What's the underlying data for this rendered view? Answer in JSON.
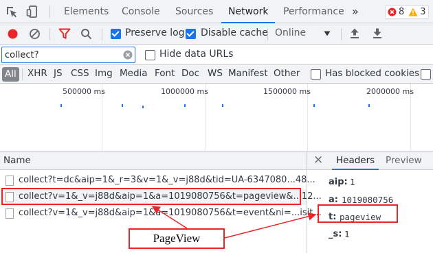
{
  "tabs": {
    "items": [
      "Elements",
      "Console",
      "Sources",
      "Network",
      "Performance"
    ],
    "active": "Network",
    "more_glyph": "»",
    "errors_count": "8",
    "warnings_count": "3"
  },
  "toolbar": {
    "preserve_log_label": "Preserve log",
    "preserve_log_checked": true,
    "disable_cache_label": "Disable cache",
    "disable_cache_checked": true,
    "throttle_value": "Online"
  },
  "filter": {
    "value": "collect?",
    "hide_data_urls_label": "Hide data URLs"
  },
  "type_filters": {
    "items": [
      "All",
      "XHR",
      "JS",
      "CSS",
      "Img",
      "Media",
      "Font",
      "Doc",
      "WS",
      "Manifest",
      "Other"
    ],
    "has_blocked_cookies_label": "Has blocked cookies"
  },
  "timeline": {
    "ticks": [
      "500000 ms",
      "1000000 ms",
      "1500000 ms",
      "2000000 ms"
    ]
  },
  "request_list": {
    "header": "Name",
    "rows": [
      "collect?t=dc&aip=1&_r=3&v=1&_v=j88d&tid=UA-6347080...48...",
      "collect?v=1&_v=j88d&aip=1&a=1019080756&t=pageview&...12...",
      "collect?v=1&_v=j88d&aip=1&a=1019080756&t=event&ni=...isit..."
    ]
  },
  "details": {
    "close_glyph": "×",
    "tabs": [
      "Headers",
      "Preview"
    ],
    "active_tab": "Headers",
    "params": [
      {
        "key": "aip:",
        "value": "1"
      },
      {
        "key": "a:",
        "value": "1019080756"
      },
      {
        "key": "t:",
        "value": "pageview"
      },
      {
        "key": "_s:",
        "value": "1"
      }
    ]
  },
  "annotation": {
    "label": "PageView"
  },
  "colors": {
    "accent": "#1a73e8",
    "record_red": "#e8262a",
    "annotation_red": "#e8262a",
    "toolbar_bg": "#f1f3f4"
  },
  "icons": [
    "inspect-icon",
    "device-toolbar-icon",
    "record-icon",
    "clear-icon",
    "filter-icon",
    "search-icon",
    "dropdown-icon",
    "upload-icon",
    "download-icon",
    "error-icon",
    "warning-icon",
    "clear-input-icon",
    "file-icon",
    "close-icon"
  ]
}
